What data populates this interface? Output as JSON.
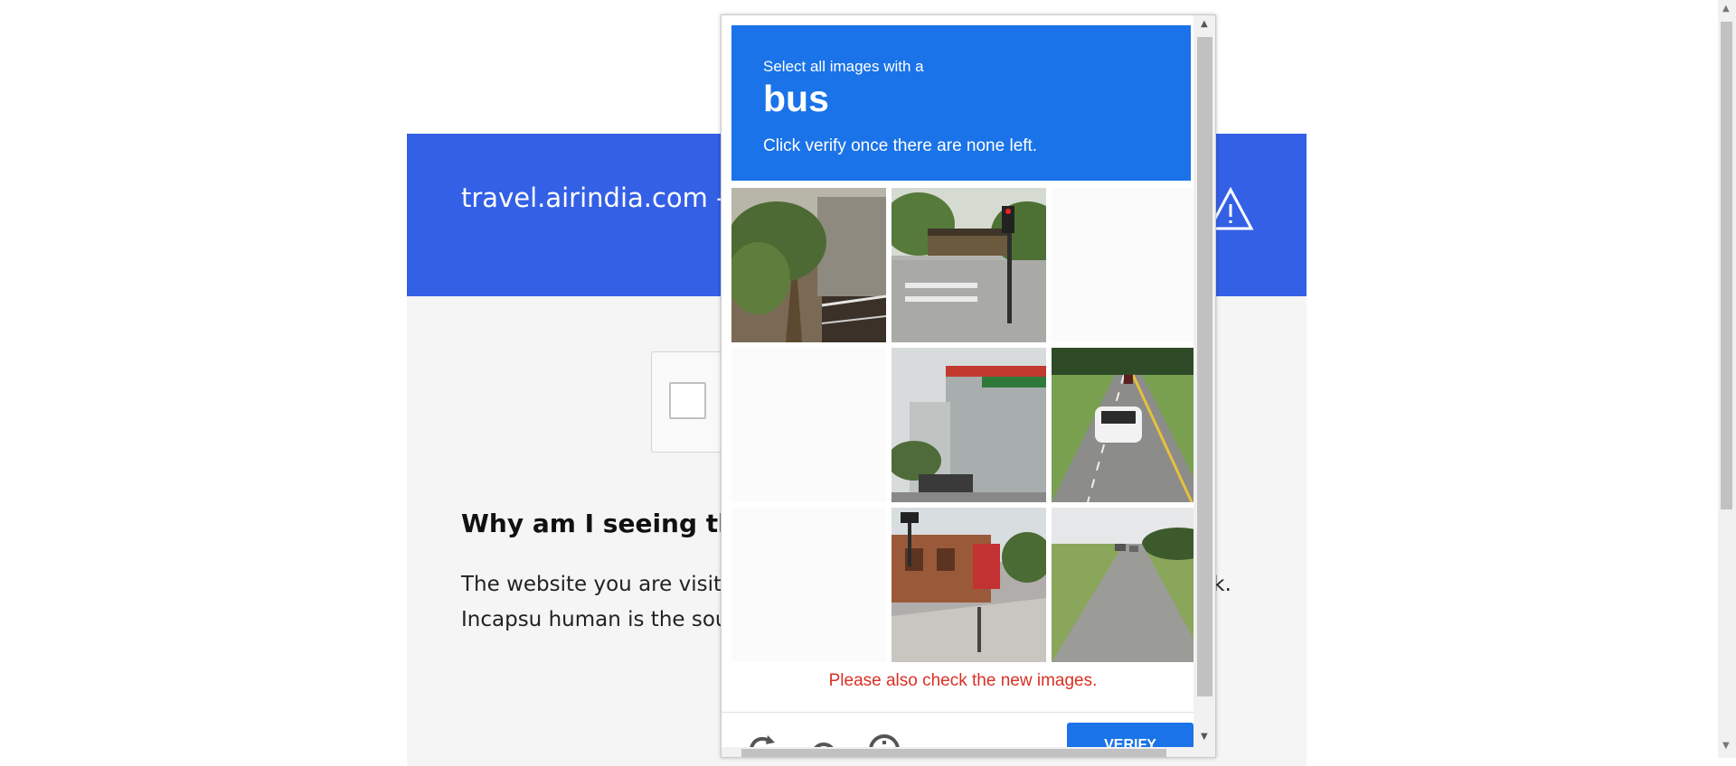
{
  "background_page": {
    "title": "travel.airindia.com - required",
    "why_heading": "Why am I seeing th",
    "why_body": "The website you are visitin computer may have been i Incapsula network. Incapsu human is the source of the"
  },
  "captcha": {
    "select_text": "Select all images with a",
    "object": "bus",
    "instruction": "Click verify once there are none left.",
    "error_text": "Please also check the new images.",
    "verify_label": "VERIFY",
    "tiles": [
      {
        "row": 1,
        "col": 1,
        "content": "palm tree and fence"
      },
      {
        "row": 1,
        "col": 2,
        "content": "intersection with traffic light"
      },
      {
        "row": 1,
        "col": 3,
        "content": "blank (loading)"
      },
      {
        "row": 2,
        "col": 1,
        "content": "blank (loading)"
      },
      {
        "row": 2,
        "col": 2,
        "content": "warehouse building"
      },
      {
        "row": 2,
        "col": 3,
        "content": "road with white car"
      },
      {
        "row": 3,
        "col": 1,
        "content": "blank (loading)"
      },
      {
        "row": 3,
        "col": 2,
        "content": "street corner with shops"
      },
      {
        "row": 3,
        "col": 3,
        "content": "highway with distant cars"
      }
    ],
    "footer_icons": [
      "reload-icon",
      "audio-icon",
      "info-icon"
    ]
  },
  "colors": {
    "header_blue": "#3460e6",
    "captcha_blue": "#1a73e8",
    "error_red": "#d93025"
  }
}
